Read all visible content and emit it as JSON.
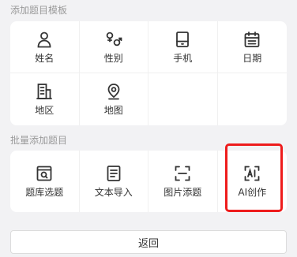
{
  "templates": {
    "section_title": "添加题目模板",
    "items": [
      {
        "label": "姓名",
        "icon": "person-icon"
      },
      {
        "label": "性别",
        "icon": "gender-icon"
      },
      {
        "label": "手机",
        "icon": "phone-icon"
      },
      {
        "label": "日期",
        "icon": "calendar-icon"
      },
      {
        "label": "地区",
        "icon": "building-icon"
      },
      {
        "label": "地图",
        "icon": "map-pin-icon"
      }
    ]
  },
  "batch": {
    "section_title": "批量添加题目",
    "items": [
      {
        "label": "题库选题",
        "icon": "question-bank-icon"
      },
      {
        "label": "文本导入",
        "icon": "document-icon"
      },
      {
        "label": "图片添题",
        "icon": "image-scan-icon"
      },
      {
        "label": "AI创作",
        "icon": "ai-icon"
      }
    ]
  },
  "footer": {
    "back_label": "返回"
  },
  "colors": {
    "background": "#f2f2f4",
    "card": "#ffffff",
    "highlight": "#ee1c1c"
  }
}
